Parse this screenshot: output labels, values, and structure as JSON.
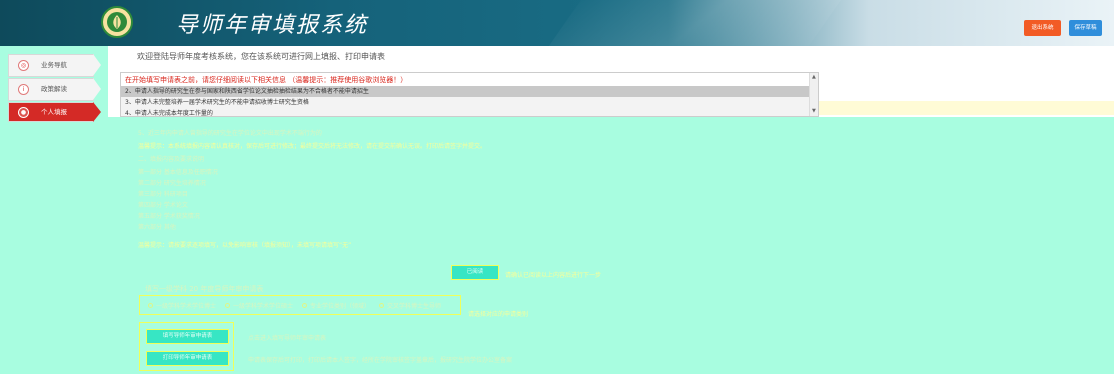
{
  "header": {
    "title": "导师年审填报系统",
    "logout_label": "退出系统",
    "save_label": "保存草稿"
  },
  "sidebar": {
    "items": [
      {
        "label": "业务导航",
        "icon": "navigation-icon"
      },
      {
        "label": "政策解读",
        "icon": "info-icon"
      },
      {
        "label": "个人填报",
        "icon": "user-icon"
      }
    ]
  },
  "main": {
    "welcome": "欢迎登陆导师年度考核系统，您在该系统可进行网上填报、打印申请表",
    "notice_head": "在开始填写申请表之前，请您仔细阅读以下相关信息    （温馨提示：推荐使用谷歌浏览器！）",
    "notice_lines": [
      "2、申请人指导的研究生在参与国家和陕西省学位论文抽检抽检结果为不合格者不能申请招生",
      "3、申请人未完整培养一届学术研究生的不能申请招收博士研究生资格",
      "4、申请人未完成本年度工作量的"
    ]
  },
  "overlay": {
    "lines": [
      "5、近三年内申请人曾指导的研究生在学位论文中出现学术不端行为的",
      "温馨提示：本系统填报内容请认真核对，保存后可进行修改；最终提交后将无法修改，请在提交前确认无误。打印后请签字并提交。",
      "二、填报内容及要求说明",
      "第一部分  基本信息及任职情况",
      "第二部分  研究生培养情况",
      "第三部分  科研项目",
      "第四部分  学术论文",
      "第五部分  学术获奖情况",
      "第六部分  其他",
      "温馨提示：请按要求逐项填写，以免影响审核（填报须知），未填写项请填写“无”"
    ],
    "agree_label": "已阅读",
    "agree_hint": "请确认已阅读以上内容后进行下一步",
    "year_title": "填写一级学科  20   年度导师年审申请表",
    "options": [
      "一级学科学术学位博士",
      "一级学科学术学位硕士",
      "专业学位类别（领域）",
      "交叉学科博士生导师"
    ],
    "options_hint": "请选择对应的申请类别",
    "actions": [
      {
        "label": "填写导师年审申请表",
        "desc": "点击进入填写导师年审申请表"
      },
      {
        "label": "打印导师年审申请表",
        "desc": "申请表保存后可打印，打印后请本人签字，经所在学院审核签字盖章后，报研究生院学位办公室备案"
      }
    ]
  }
}
